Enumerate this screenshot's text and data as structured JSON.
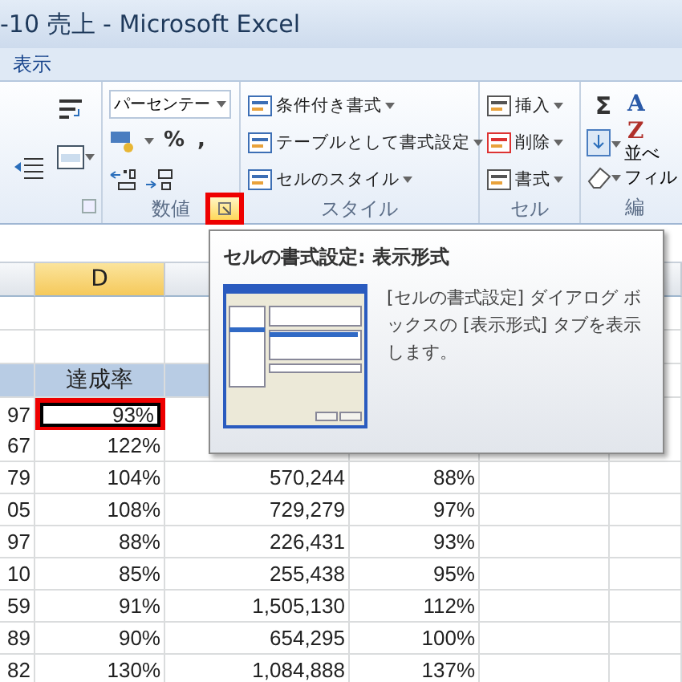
{
  "window": {
    "title": "-10 売上 - Microsoft Excel"
  },
  "menu": [
    {
      "label": "表示"
    }
  ],
  "ribbon": {
    "number_group": {
      "format_field": "パーセンテー",
      "buttons": [
        "%",
        ","
      ],
      "label": "数値",
      "launcher_highlighted": true
    },
    "styles_group": {
      "commands": [
        "条件付き書式",
        "テーブルとして書式設定",
        "セルのスタイル"
      ],
      "label": "スタイル"
    },
    "cells_group": {
      "commands": [
        "挿入",
        "削除",
        "書式"
      ],
      "label": "セル"
    },
    "editing_group": {
      "sum_symbol": "Σ",
      "sort_icon": [
        "A",
        "Z"
      ],
      "sort_label": [
        "並べ",
        "フィル"
      ],
      "label": "編"
    }
  },
  "sheet": {
    "columns": [
      {
        "label": "D",
        "selected": true
      }
    ],
    "header_label": "達成率",
    "rows": [
      {
        "c": "97",
        "d": "93%",
        "selected": true
      },
      {
        "c": "67",
        "d": "122%",
        "selected": false
      },
      {
        "c": "79",
        "d": "104%",
        "e": "570,244",
        "f": "88%",
        "selected": false
      },
      {
        "c": "05",
        "d": "108%",
        "e": "729,279",
        "f": "97%",
        "selected": false
      },
      {
        "c": "97",
        "d": "88%",
        "e": "226,431",
        "f": "93%",
        "selected": false
      },
      {
        "c": "10",
        "d": "85%",
        "e": "255,438",
        "f": "95%",
        "selected": false
      },
      {
        "c": "59",
        "d": "91%",
        "e": "1,505,130",
        "f": "112%",
        "selected": false
      },
      {
        "c": "89",
        "d": "90%",
        "e": "654,295",
        "f": "100%",
        "selected": false
      },
      {
        "c": "82",
        "d": "130%",
        "e": "1,084,888",
        "f": "137%",
        "selected": false
      }
    ]
  },
  "tooltip": {
    "title": "セルの書式設定: 表示形式",
    "description": "[セルの書式設定] ダイアログ ボックスの [表示形式] タブを表示します。"
  }
}
